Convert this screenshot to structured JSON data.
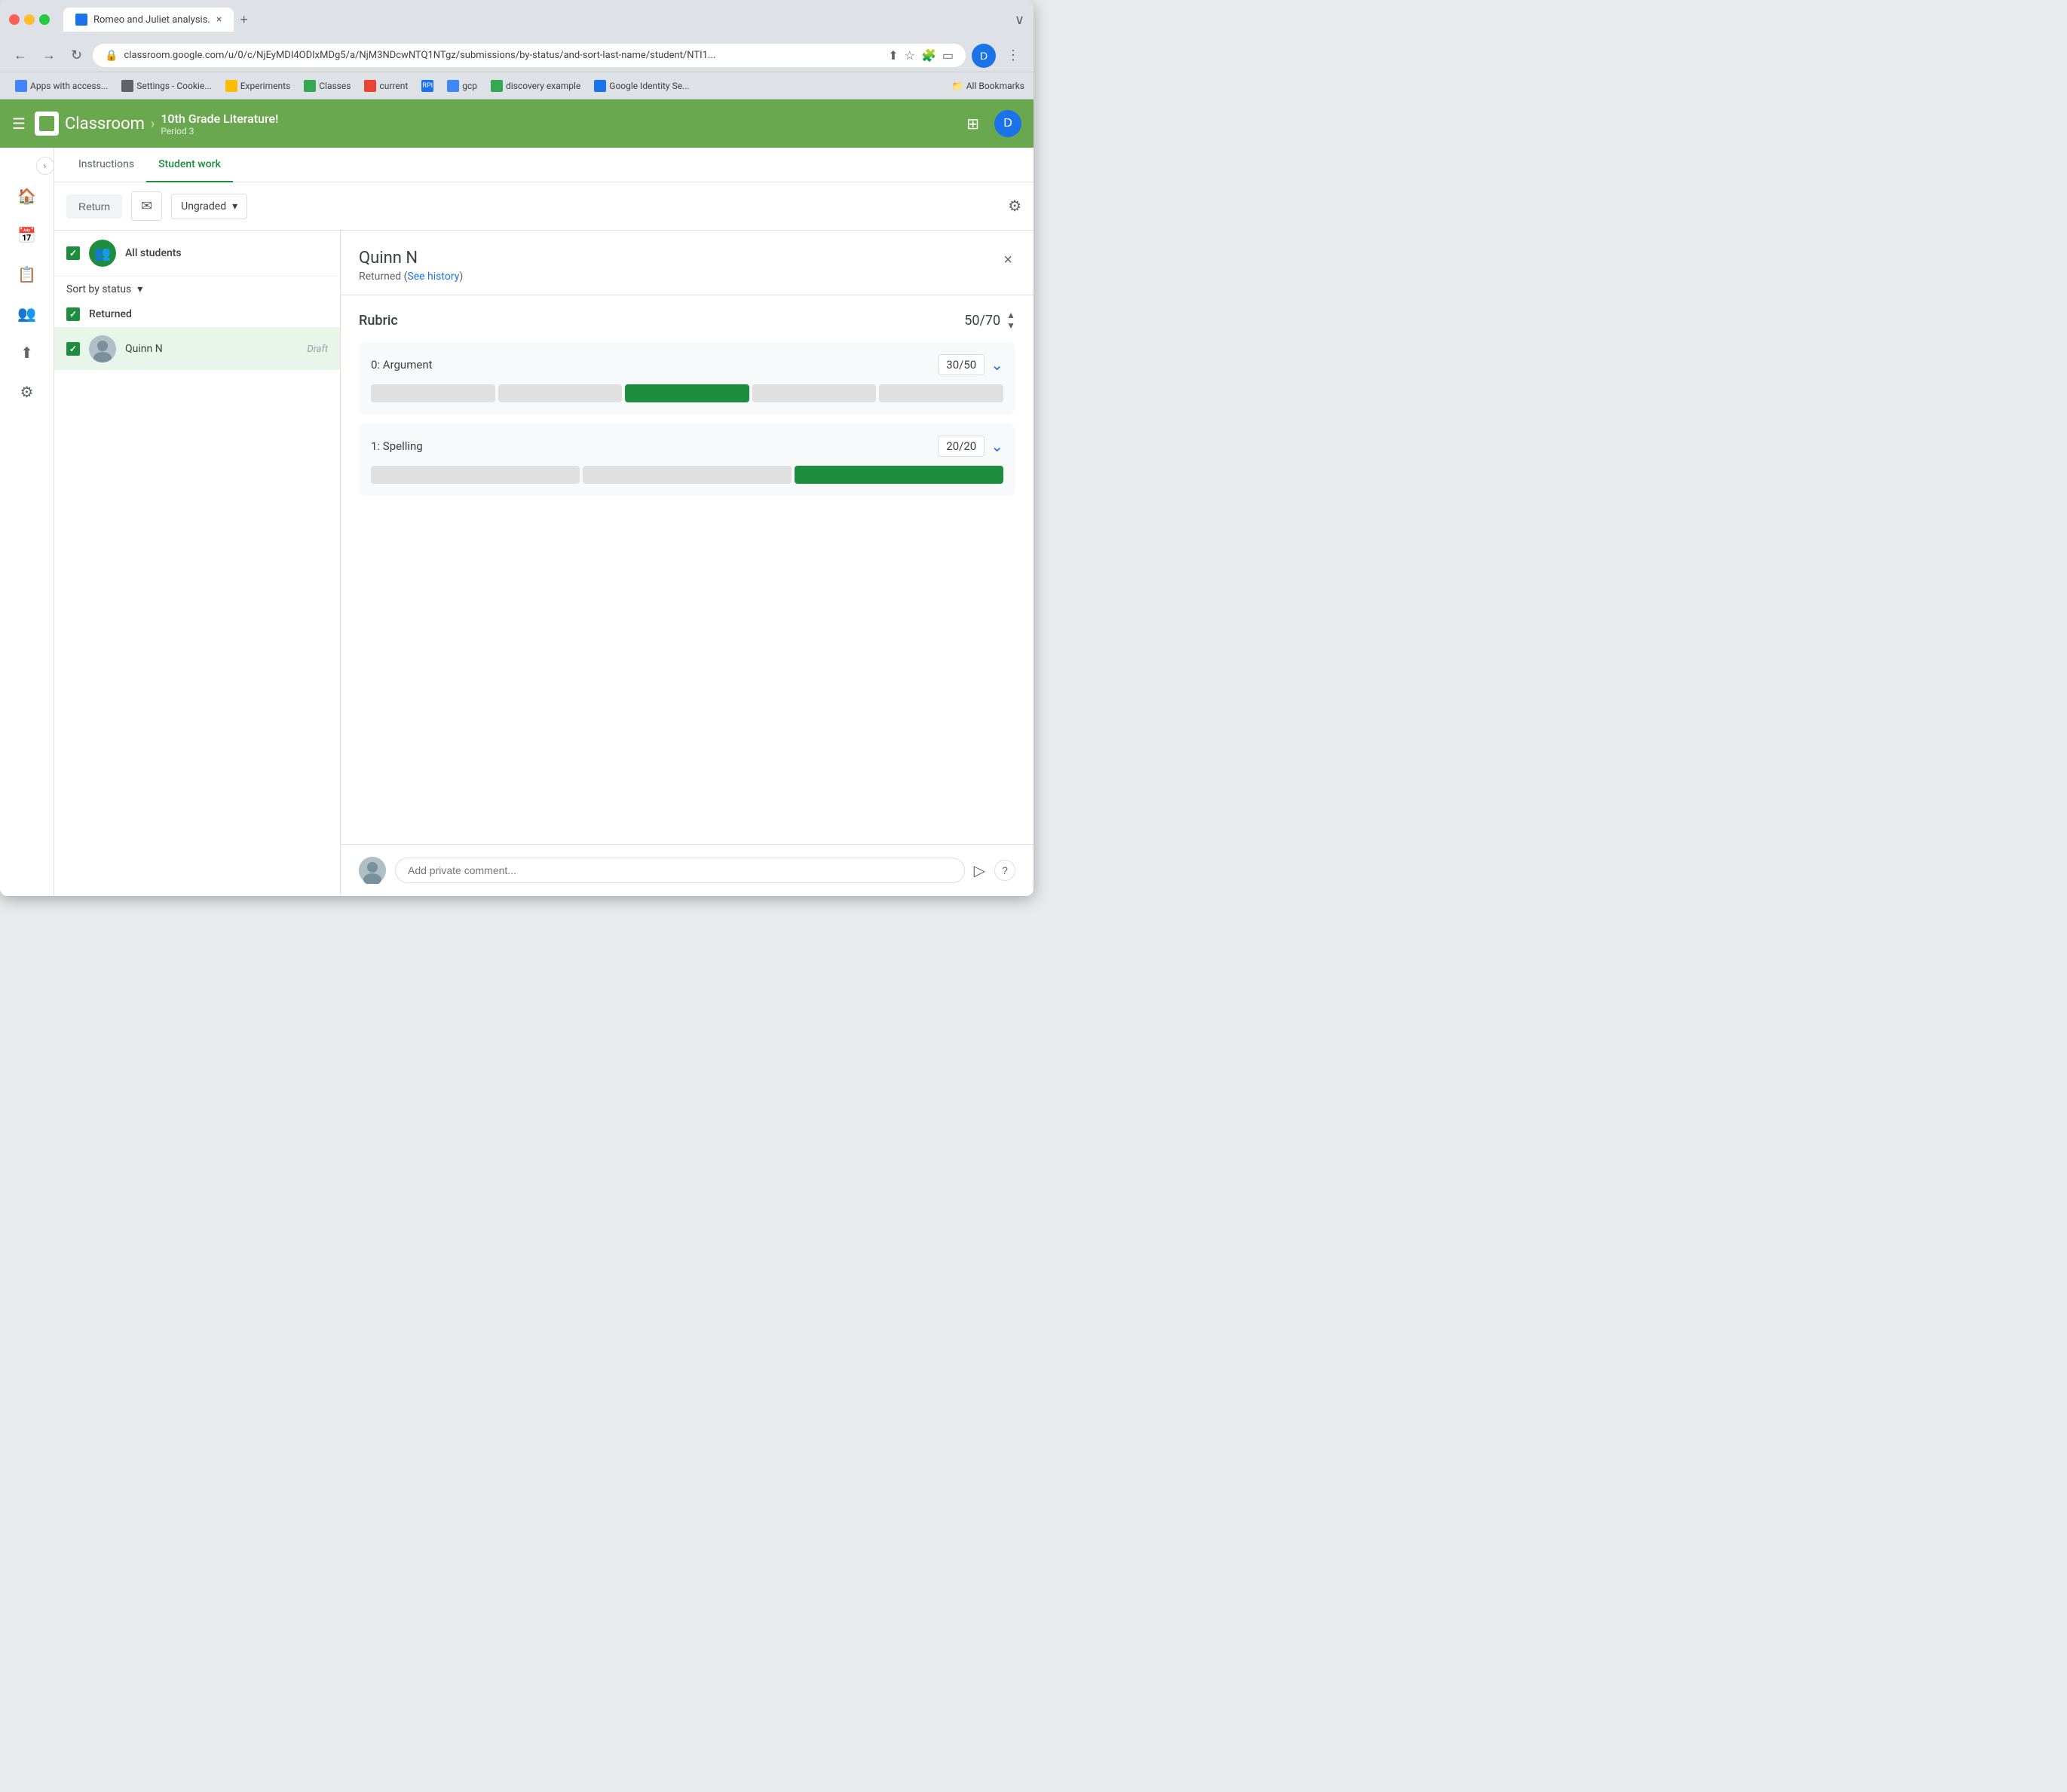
{
  "browser": {
    "tab_title": "Romeo and Juliet analysis.",
    "url": "classroom.google.com/u/0/c/NjEyMDI4ODIxMDg5/a/NjM3NDcwNTQ1NTgz/submissions/by-status/and-sort-last-name/student/NTI1...",
    "new_tab_label": "+",
    "window_control_label": "∨"
  },
  "bookmarks": {
    "items": [
      {
        "label": "Apps with access...",
        "icon": "google"
      },
      {
        "label": "Settings - Cookie...",
        "icon": "settings"
      },
      {
        "label": "Experiments",
        "icon": "experiments"
      },
      {
        "label": "Classes",
        "icon": "classes"
      },
      {
        "label": "current",
        "icon": "current"
      },
      {
        "label": "gcp",
        "icon": "gcp"
      },
      {
        "label": "discovery example",
        "icon": "discovery"
      },
      {
        "label": "Google Identity Se...",
        "icon": "gis"
      }
    ],
    "all_bookmarks_label": "All Bookmarks"
  },
  "header": {
    "menu_icon": "☰",
    "logo_text": "Classroom",
    "breadcrumb_sep": "›",
    "course_name": "10th Grade Literature!",
    "course_period": "Period 3",
    "avatar_letter": "D"
  },
  "tabs": {
    "instructions_label": "Instructions",
    "student_work_label": "Student work"
  },
  "toolbar": {
    "return_label": "Return",
    "grade_label": "Ungraded"
  },
  "student_list": {
    "all_students_label": "All students",
    "sort_label": "Sort by status",
    "section_label": "Returned",
    "students": [
      {
        "name": "Quinn N",
        "status": "Draft"
      }
    ]
  },
  "detail": {
    "student_name": "Quinn N",
    "status": "Returned (See history)",
    "close_label": "×",
    "rubric": {
      "title": "Rubric",
      "total_score": "50",
      "total_max": "70",
      "items": [
        {
          "name": "0: Argument",
          "score": "30",
          "max": "50",
          "segments": 5,
          "filled_index": 2
        },
        {
          "name": "1: Spelling",
          "score": "20",
          "max": "20",
          "segments": 3,
          "filled_index": 2
        }
      ]
    },
    "comment_placeholder": "Add private comment..."
  },
  "sidebar": {
    "icons": [
      "🏠",
      "📅",
      "📋",
      "⬆",
      "⚙"
    ]
  }
}
